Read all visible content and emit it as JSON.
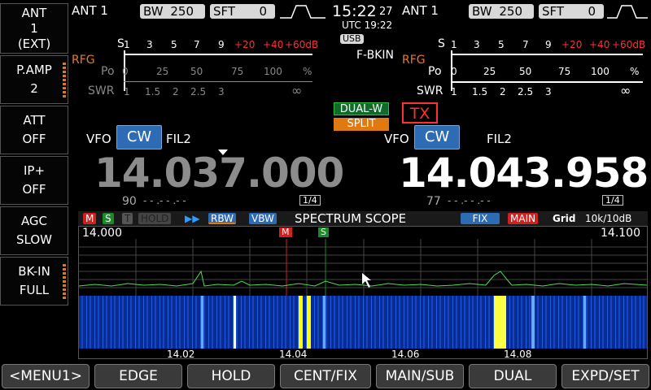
{
  "left_buttons": [
    {
      "line1": "ANT",
      "line2": "1",
      "line3": "(EXT)"
    },
    {
      "line1": "P.AMP",
      "line2": "2"
    },
    {
      "line1": "ATT",
      "line2": "OFF"
    },
    {
      "line1": "IP+",
      "line2": "OFF"
    },
    {
      "line1": "AGC",
      "line2": "SLOW"
    },
    {
      "line1": "BK-IN",
      "line2": "FULL"
    }
  ],
  "main": {
    "ant": "ANT 1",
    "bw_label": "BW",
    "bw_value": "250",
    "sft_label": "SFT",
    "sft_value": "0",
    "vfo_label": "VFO",
    "mode": "CW",
    "filter": "FIL2",
    "freq": "14.037.000",
    "s_val": "90",
    "dashes": "- - .- - .- -",
    "step": "1/4",
    "rfg": "RFG"
  },
  "sub": {
    "ant": "ANT 1",
    "bw_label": "BW",
    "bw_value": "250",
    "sft_label": "SFT",
    "sft_value": "0",
    "vfo_label": "VFO",
    "mode": "CW",
    "filter": "FIL2",
    "freq": "14.043.958",
    "s_val": "77",
    "dashes": "- - .- - .- -",
    "step": "1/4",
    "rfg": "RFG"
  },
  "center": {
    "time": "15:22",
    "seconds": "27",
    "utc": "UTC 19:22",
    "usb": "USB",
    "fbkin": "F-BKIN",
    "dualw": "DUAL-W",
    "split": "SPLIT",
    "tx": "TX"
  },
  "meter": {
    "s_label": "S",
    "po_label": "Po",
    "swr_label": "SWR",
    "s_scale": [
      "1",
      "3",
      "5",
      "7",
      "9"
    ],
    "s_over": [
      "+20",
      "+40",
      "+60dB"
    ],
    "po_scale": [
      "0",
      "25",
      "50",
      "75",
      "100",
      "%"
    ],
    "swr_scale": [
      "1",
      "1.5",
      "2",
      "2.5",
      "3",
      "∞"
    ]
  },
  "scope": {
    "title": "SPECTRUM SCOPE",
    "tags": {
      "m": "M",
      "s": "S",
      "t": "T",
      "hold": "HOLD",
      "arrows": "▶▶",
      "rbw": "RBW",
      "vbw": "VBW",
      "fix": "FIX",
      "main": "MAIN",
      "grid": "Grid",
      "scale": "10k/10dB"
    },
    "start": "14.000",
    "end": "14.100",
    "markers": {
      "m": "M",
      "s": "S"
    },
    "x_ticks": [
      "14.02",
      "14.04",
      "14.06",
      "14.08"
    ]
  },
  "bottom_buttons": [
    "<MENU1>",
    "EDGE",
    "HOLD",
    "CENT/FIX",
    "MAIN/SUB",
    "DUAL",
    "EXPD/SET"
  ],
  "colors": {
    "accent_blue": "#2d6bb5",
    "red": "#ff3030",
    "green": "#2fbf3a",
    "orange": "#e07a10",
    "rfg": "#e07a30"
  }
}
